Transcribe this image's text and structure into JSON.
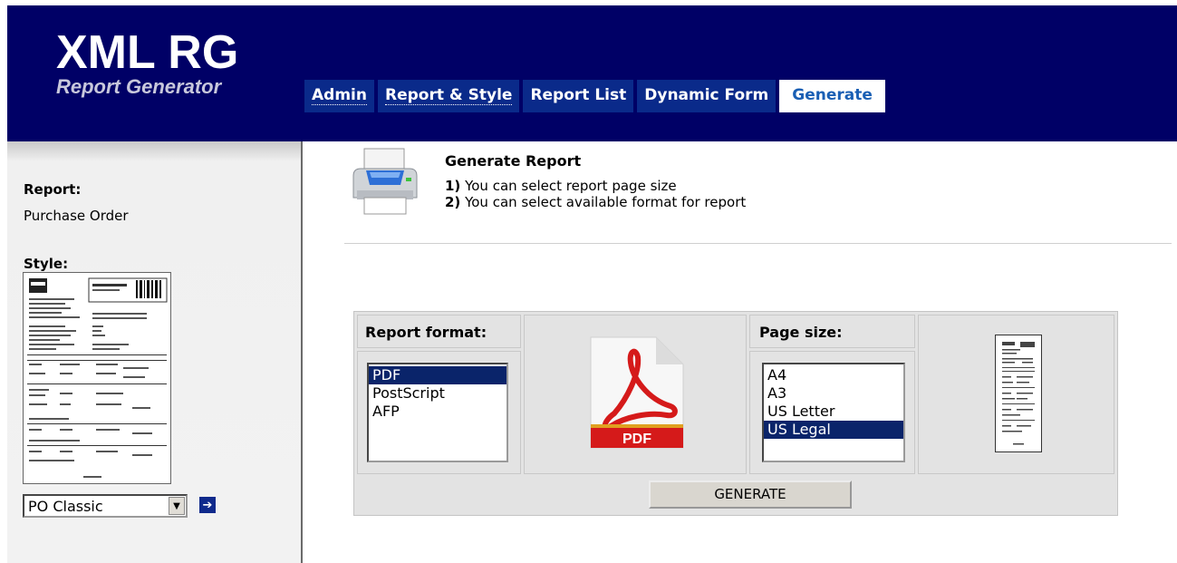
{
  "header": {
    "logo_title": "XML RG",
    "logo_subtitle": "Report Generator",
    "tabs": [
      {
        "label": "Admin"
      },
      {
        "label": "Report & Style"
      },
      {
        "label": "Report List"
      },
      {
        "label": "Dynamic Form"
      },
      {
        "label": "Generate"
      }
    ],
    "active_tab": "Generate"
  },
  "sidebar": {
    "report_label": "Report:",
    "report_value": "Purchase Order",
    "style_label": "Style:",
    "style_select": {
      "selected": "PO Classic"
    }
  },
  "main": {
    "title": "Generate Report",
    "steps": [
      {
        "num": "1)",
        "text": "You can select report page size"
      },
      {
        "num": "2)",
        "text": "You can select available format for report"
      }
    ],
    "format": {
      "label": "Report format:",
      "options": [
        "PDF",
        "PostScript",
        "AFP"
      ],
      "selected": "PDF",
      "icon_text": "PDF"
    },
    "page_size": {
      "label": "Page size:",
      "options": [
        "A4",
        "A3",
        "US Letter",
        "US Legal"
      ],
      "selected": "US Legal"
    },
    "generate_label": "GENERATE"
  },
  "colors": {
    "header_bg": "#000066",
    "tab_bg": "#0a2a8a",
    "active_tab_text": "#1a5fb4",
    "selection_bg": "#0a246a",
    "pdf_red": "#d51a1a"
  },
  "icons": {
    "printer": "printer-icon",
    "pdf": "pdf-file-icon",
    "page_preview": "page-preview-icon",
    "go": "arrow-right-icon",
    "dropdown": "chevron-down-icon"
  }
}
